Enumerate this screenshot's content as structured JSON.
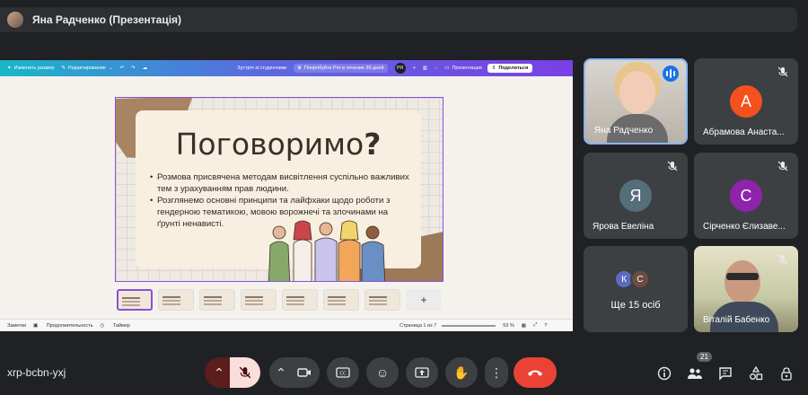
{
  "presenter_bar": {
    "title": "Яна Радченко (Презентація)"
  },
  "canva": {
    "toolbar": {
      "resize": "Изменить размер",
      "edit": "Редактирование",
      "doc_title": "Зустріч зі студентами",
      "pro": "Попробуйте Pro в течение 30 дней",
      "user_initials": "РЯ",
      "present": "Презентация",
      "share": "Поделиться"
    },
    "footer": {
      "notes": "Заметки",
      "duration": "Продолжительность",
      "timer": "Таймер",
      "page": "Страница 1 из 7",
      "zoom": "53 %"
    },
    "thumbnail_add": "+"
  },
  "slide": {
    "heading": "Поговоримо",
    "heading_mark": "?",
    "bullets": [
      "Розмова присвячена методам висвітлення суспільно важливих тем з урахуванням прав людини.",
      "Розглянемо основні принципи та лайфхаки щодо роботи з гендерною тематикою, мовою ворожнечі та злочинами на ґрунті ненависті."
    ]
  },
  "participants": [
    {
      "name": "Яна Радченко"
    },
    {
      "name": "Абрамова Анаста...",
      "initial": "А",
      "color": "#f4511e"
    },
    {
      "name": "Ярова Евеліна",
      "initial": "Я",
      "color": "#546e7a"
    },
    {
      "name": "Сірченко Єлизаве...",
      "initial": "С",
      "color": "#8e24aa"
    },
    {
      "label": "Ще 15 осіб",
      "avatar1": "К",
      "avatar1_color": "#5c6bc0",
      "avatar2": "С",
      "avatar2_color": "#6d4c41"
    },
    {
      "name": "Віталій Бабенко"
    }
  ],
  "bottom": {
    "meeting_code": "xrp-bcbn-yxj",
    "participants_badge": "21"
  },
  "icons": {
    "mic_off": "mic-off-icon",
    "camera": "camera-icon",
    "captions": "captions-icon",
    "emoji": "emoji-icon",
    "present": "present-screen-icon",
    "hand": "raise-hand-icon",
    "more": "more-options-icon",
    "hangup": "hang-up-icon",
    "info": "info-icon",
    "people": "people-icon",
    "chat": "chat-icon",
    "activities": "activities-icon",
    "host": "host-controls-icon"
  }
}
